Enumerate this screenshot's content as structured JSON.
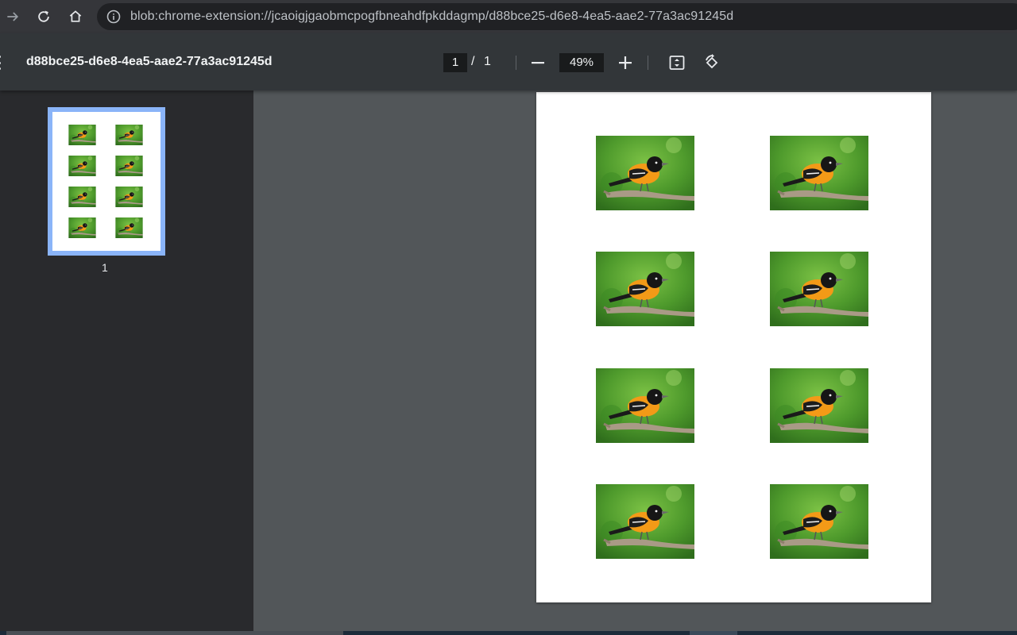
{
  "browser": {
    "url": "blob:chrome-extension://jcaoigjgaobmcpogfbneahdfpkddagmp/d88bce25-d6e8-4ea5-aae2-77a3ac91245d",
    "icons": [
      "forward-icon",
      "reload-icon",
      "home-icon",
      "site-info-icon"
    ]
  },
  "toolbar": {
    "title": "d88bce25-d6e8-4ea5-aae2-77a3ac91245d",
    "current_page": "1",
    "separator": "/",
    "total_pages": "1",
    "zoom": "49%",
    "icons": [
      "menu-icon",
      "zoom-out-icon",
      "zoom-in-icon",
      "fit-to-page-icon",
      "rotate-icon"
    ]
  },
  "sidebar": {
    "thumbnails": [
      {
        "label": "1",
        "selected": true
      }
    ]
  },
  "document": {
    "pages": 1,
    "image_count": 8,
    "image_subject": "oriole-bird-photo"
  },
  "colors": {
    "toolbar_bg": "#323639",
    "sidebar_bg": "#292a2d",
    "viewer_bg": "#525659",
    "selection": "#8ab4f8"
  }
}
